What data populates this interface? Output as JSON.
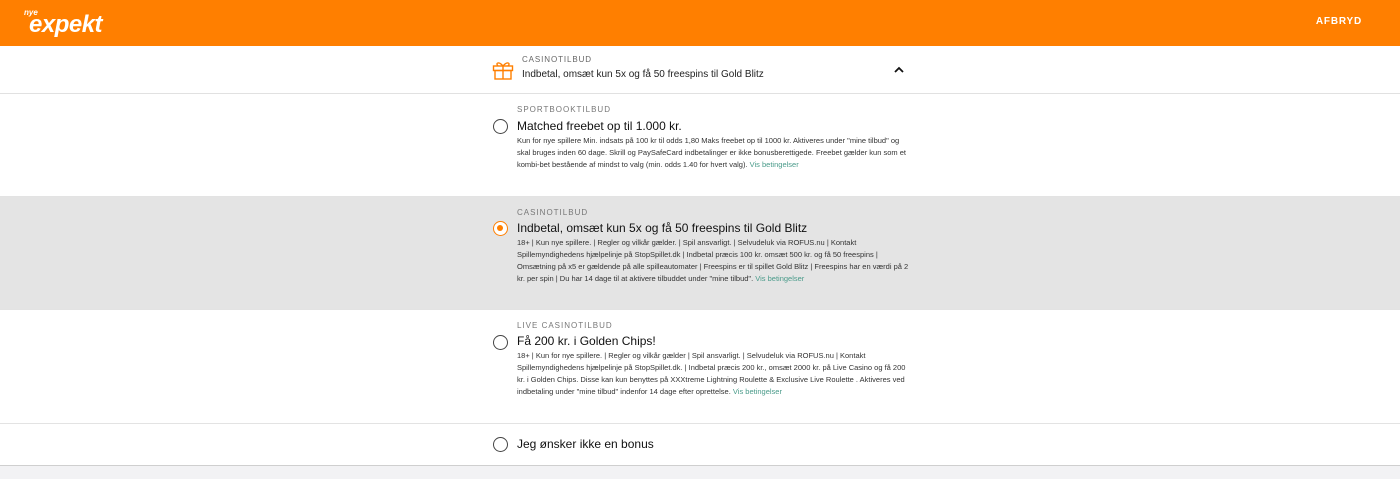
{
  "topbar": {
    "logo_small": "nye",
    "logo_main": "expekt",
    "cancel_label": "AFBRYD"
  },
  "header": {
    "category": "CASINOTILBUD",
    "title": "Indbetal, omsæt kun 5x og få 50 freespins til Gold Blitz",
    "icon": "gift-icon",
    "toggle_icon": "chevron-up-icon"
  },
  "offers": [
    {
      "category": "SPORTBOOKTILBUD",
      "title": "Matched freebet op til 1.000 kr.",
      "description": "Kun for nye spillere Min. indsats på 100 kr til odds 1,80 Maks freebet op til 1000 kr. Aktiveres under \"mine tilbud\" og skal bruges inden 60 dage. Skrill og PaySafeCard indbetalinger er ikke bonusberettigede. Freebet gælder kun som et kombi-bet bestående af mindst to valg (min. odds 1.40 for hvert valg).",
      "link": "Vis betingelser",
      "selected": false
    },
    {
      "category": "CASINOTILBUD",
      "title": "Indbetal, omsæt kun 5x og få 50 freespins til Gold Blitz",
      "description": "18+ | Kun nye spillere. | Regler og vilkår gælder. | Spil ansvarligt. | Selvudeluk via ROFUS.nu | Kontakt Spillemyndighedens hjælpelinje på StopSpillet.dk | Indbetal præcis 100 kr. omsæt 500 kr. og få 50 freespins | Omsætning på x5 er gældende på alle spilleautomater | Freespins er til spillet Gold Blitz | Freespins har en værdi på 2 kr. per spin | Du har 14 dage til at aktivere tilbuddet under \"mine tilbud\".",
      "link": "Vis betingelser",
      "selected": true
    },
    {
      "category": "LIVE CASINOTILBUD",
      "title": "Få 200 kr. i Golden Chips!",
      "description": "18+ | Kun for nye spillere. | Regler og vilkår gælder | Spil ansvarligt. | Selvudeluk via ROFUS.nu | Kontakt Spillemyndighedens hjælpelinje på StopSpillet.dk. | Indbetal præcis 200 kr., omsæt 2000 kr. på Live Casino og få 200 kr. i Golden Chips. Disse kan kun benyttes på XXXtreme Lightning Roulette & Exclusive Live Roulette . Aktiveres ved indbetaling under \"mine tilbud\" indenfor 14 dage efter oprettelse.",
      "link": "Vis betingelser",
      "selected": false
    }
  ],
  "no_bonus": {
    "label": "Jeg ønsker ikke en bonus",
    "selected": false
  },
  "colors": {
    "brand": "#ff7f00",
    "link": "#4a9b8a",
    "selected_row": "#e4e4e4"
  }
}
